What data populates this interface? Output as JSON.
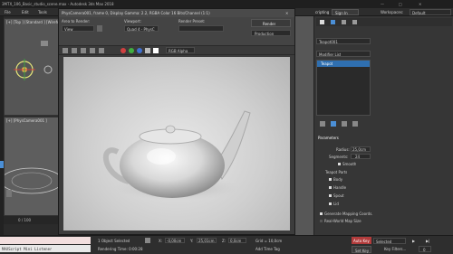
{
  "window": {
    "title": "3MTX_106_Basic_studio_scene.max - Autodesk 3ds Max 2018",
    "scripting_label": "cripting",
    "signin_label": "Sign In",
    "workspaces_label": "Workspaces:",
    "workspace_value": "Default"
  },
  "menu": {
    "items": [
      "File",
      "Edit",
      "Tools"
    ]
  },
  "left_viewports": {
    "top_label": "[+] [Top ] [Standard ] [Wireframe ]",
    "cam_label": "[+] [PhysCamera001 ]",
    "time_label": "0 / 100"
  },
  "render_window": {
    "title": "PhysCamera001, frame 0, Display Gamma: 2.2, RGBA Color 16 Bits/Channel (1:1)",
    "area_label": "Area to Render:",
    "area_value": "View",
    "viewport_label": "Viewport:",
    "viewport_value": "Quad 4 - PhysC",
    "preset_label": "Render Preset:",
    "render_button": "Render",
    "production_value": "Production",
    "channel_value": "RGB Alpha"
  },
  "command_panel": {
    "object_name": "Teapot001",
    "modifier_list": "Modifier List",
    "stack_item": "Teapot",
    "rollout_title": "Parameters",
    "radius_label": "Radius:",
    "radius_value": "25,0cm",
    "segments_label": "Segments:",
    "segments_value": "24",
    "smooth_label": "Smooth",
    "teapot_parts_label": "Teapot Parts",
    "parts": [
      "Body",
      "Handle",
      "Spout",
      "Lid"
    ],
    "gen_mapping": "Generate Mapping Coords.",
    "real_world": "Real-World Map Size"
  },
  "status": {
    "maxscript": "MAXScript Mini Listener",
    "selected": "1 Object Selected",
    "render_time": "Rendering Time: 0:00:28",
    "x_value": "-0,00cm",
    "y_value": "25,01cm",
    "z_value": "0,0cm",
    "grid": "Grid = 10,0cm",
    "add_time_tag": "Add Time Tag",
    "auto_key": "Auto Key",
    "set_key": "Set Key",
    "selected_dropdown": "Selected",
    "key_filters": "Key Filters...",
    "frame": "0"
  },
  "colors": {
    "accent_blue": "#4b8fd6",
    "selection_blue": "#2f6fb0",
    "auto_key_red": "#b23b3b"
  },
  "icons": [
    "search-icon",
    "gear-icon",
    "camera-icon",
    "teapot-icon",
    "lock-icon",
    "play-icon"
  ]
}
